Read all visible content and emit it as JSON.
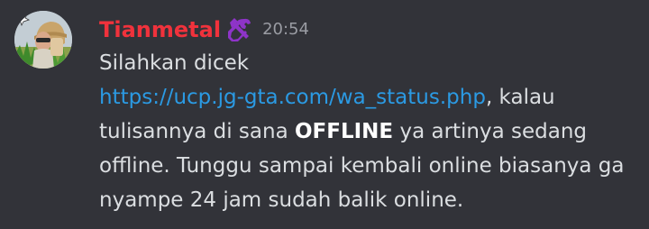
{
  "message": {
    "author": "Tianmetal",
    "role_icon": "hammer-wrench-icon",
    "timestamp": "20:54",
    "lines": {
      "l1": "Silahkan dicek",
      "l2_link": "https://ucp.jg-gta.com/wa_status.php",
      "l2_rest": ", kalau",
      "l3_pre": "tulisannya di sana ",
      "l3_bold": "OFFLINE",
      "l3_post": " ya artinya sedang",
      "l4": "offline. Tunggu sampai kembali online biasanya ga",
      "l5": "nyampe 24 jam sudah balik online."
    }
  },
  "colors": {
    "background": "#323339",
    "username": "#f0323c",
    "link": "#2b9ae3",
    "text": "#dbdee1",
    "timestamp": "#9a9ca3",
    "role_icon": "#8e34c8"
  }
}
